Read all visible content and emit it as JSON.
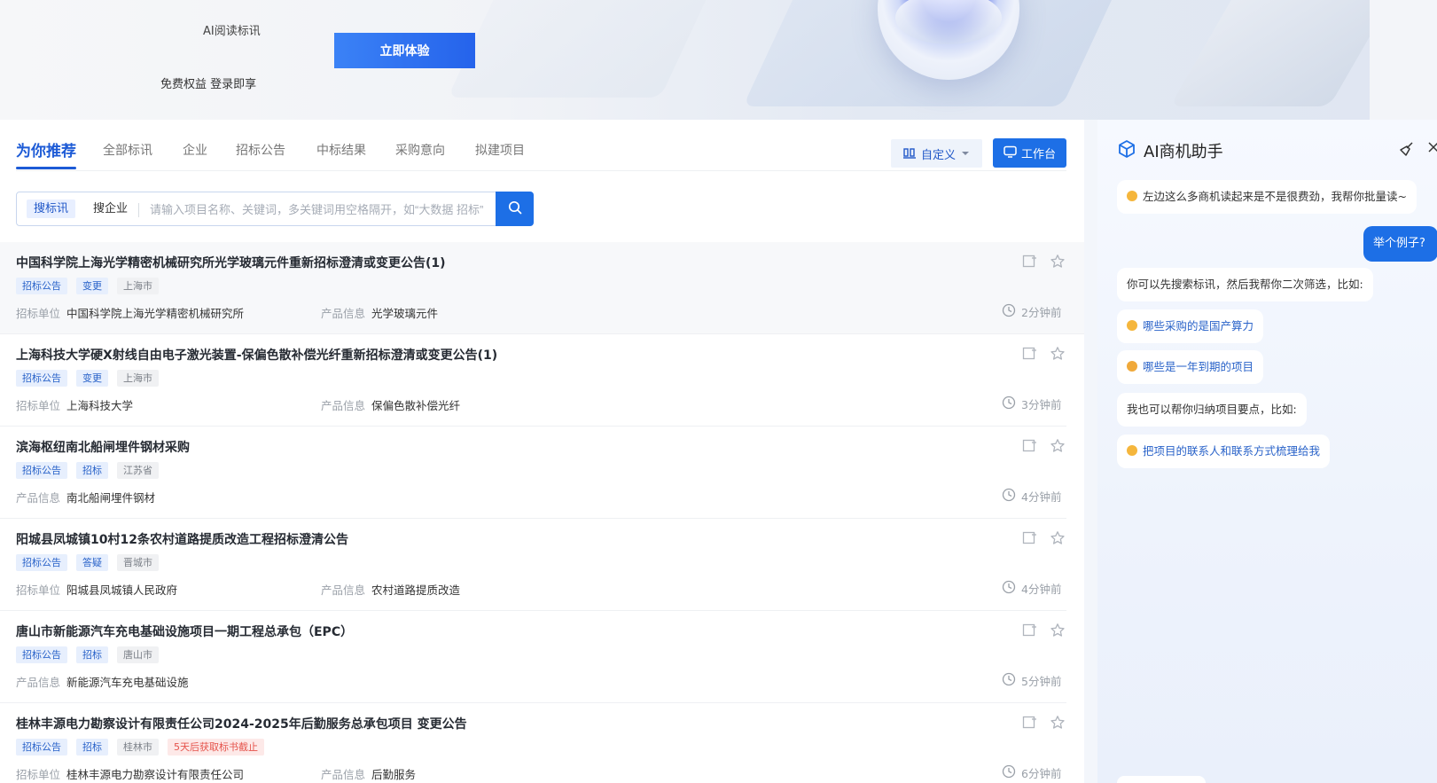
{
  "banner": {
    "line1": "AI阅读标讯",
    "line2": "免费权益 登录即享",
    "cta": "立即体验"
  },
  "tabs": [
    {
      "label": "为你推荐",
      "active": true
    },
    {
      "label": "全部标讯"
    },
    {
      "label": "企业"
    },
    {
      "label": "招标公告"
    },
    {
      "label": "中标结果"
    },
    {
      "label": "采购意向"
    },
    {
      "label": "拟建项目"
    }
  ],
  "toolbar": {
    "custom_label": "自定义",
    "work_label": "工作台"
  },
  "search": {
    "mode_active": "搜标讯",
    "mode_other": "搜企业",
    "placeholder": "请输入项目名称、关键词，多关键词用空格隔开，如“大数据 招标”"
  },
  "list": [
    {
      "title": "中国科学院上海光学精密机械研究所光学玻璃元件重新招标澄清或变更公告(1)",
      "tags": [
        "招标公告",
        "变更",
        "上海市"
      ],
      "meta": [
        {
          "k": "招标单位",
          "v": "中国科学院上海光学精密机械研究所"
        },
        {
          "k": "产品信息",
          "v": "光学玻璃元件"
        }
      ],
      "time": "2分钟前"
    },
    {
      "title": "上海科技大学硬X射线自由电子激光装置-保偏色散补偿光纤重新招标澄清或变更公告(1)",
      "tags": [
        "招标公告",
        "变更",
        "上海市"
      ],
      "meta": [
        {
          "k": "招标单位",
          "v": "上海科技大学"
        },
        {
          "k": "产品信息",
          "v": "保偏色散补偿光纤"
        }
      ],
      "time": "3分钟前"
    },
    {
      "title": "滨海枢纽南北船闸埋件钢材采购",
      "tags": [
        "招标公告",
        "招标",
        "江苏省"
      ],
      "meta": [
        {
          "k": "产品信息",
          "v": "南北船闸埋件钢材"
        }
      ],
      "time": "4分钟前"
    },
    {
      "title": "阳城县凤城镇10村12条农村道路提质改造工程招标澄清公告",
      "tags": [
        "招标公告",
        "答疑",
        "晋城市"
      ],
      "meta": [
        {
          "k": "招标单位",
          "v": "阳城县凤城镇人民政府"
        },
        {
          "k": "产品信息",
          "v": "农村道路提质改造"
        }
      ],
      "time": "4分钟前"
    },
    {
      "title": "唐山市新能源汽车充电基础设施项目一期工程总承包（EPC）",
      "tags": [
        "招标公告",
        "招标",
        "唐山市"
      ],
      "meta": [
        {
          "k": "产品信息",
          "v": "新能源汽车充电基础设施"
        }
      ],
      "time": "5分钟前"
    },
    {
      "title": "桂林丰源电力勘察设计有限责任公司2024-2025年后勤服务总承包项目 变更公告",
      "tags": [
        "招标公告",
        "招标",
        "桂林市",
        "5天后获取标书截止"
      ],
      "meta": [
        {
          "k": "招标单位",
          "v": "桂林丰源电力勘察设计有限责任公司"
        },
        {
          "k": "产品信息",
          "v": "后勤服务"
        }
      ],
      "time": "6分钟前"
    }
  ],
  "ai": {
    "title": "AI商机助手",
    "msg1": "左边这么多商机读起来是不是很费劲，我帮你批量读~",
    "user_msg": "举个例子?",
    "msg2": "你可以先搜索标讯，然后我帮你二次筛选，比如:",
    "suggest1": "哪些采购的是国产算力",
    "suggest2": "哪些是一年到期的项目",
    "msg3": "我也可以帮你归纳项目要点，比如:",
    "suggest3": "把项目的联系人和联系方式梳理给我"
  },
  "colors": {
    "accent": "#1d6fe6",
    "tag_blue": "#2a63c9",
    "tag_red": "#e5534b"
  }
}
